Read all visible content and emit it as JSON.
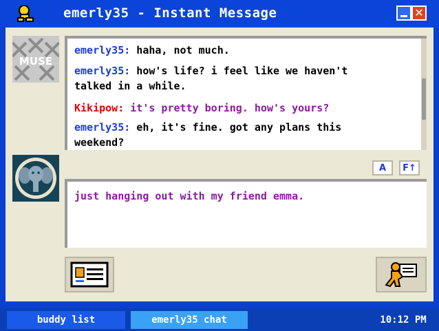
{
  "window": {
    "title": "emerly35 - Instant Message",
    "icons": {
      "logo": "aim-running-man-icon",
      "minimize": "minimize-icon",
      "close": "close-icon"
    },
    "close_glyph": "✕"
  },
  "colors": {
    "titlebar": "#0a44d8",
    "panel": "#ece8d6",
    "self_name": "#1e3ad6",
    "buddy_name": "#e00000",
    "buddy_text": "#8a1aa0",
    "taskbar": "#0a3fb5"
  },
  "avatars": {
    "self": {
      "label": "MUSE",
      "icon": "muse-buddy-icon"
    },
    "buddy": {
      "icon": "elephant-buddy-icon"
    }
  },
  "conversation": [
    {
      "sender": "emerly35:",
      "text": " haha, not much.",
      "self": true
    },
    {
      "sender": "emerly35:",
      "text": " how's life? i feel like we haven't talked in a while.",
      "self": true
    },
    {
      "sender": "Kikipow:",
      "text": " it's pretty boring. how's yours?",
      "self": false
    },
    {
      "sender": "emerly35:",
      "text": " eh, it's fine. got any plans this weekend?",
      "self": true
    }
  ],
  "format_buttons": {
    "font_color": "A",
    "font_size": "F↑"
  },
  "compose": {
    "text": "just hanging out with my friend emma."
  },
  "buttons": {
    "profile_icon": "profile-card-icon",
    "send_icon": "send-message-icon"
  },
  "taskbar": {
    "buddy_list": "buddy list",
    "chat_tab": "emerly35 chat",
    "clock": "10:12 PM"
  }
}
